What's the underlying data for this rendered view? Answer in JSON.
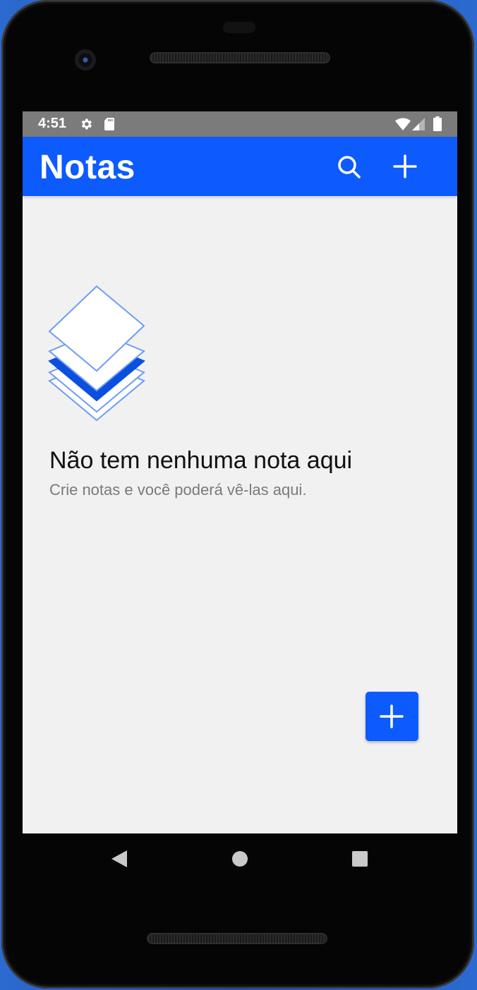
{
  "status_bar": {
    "time": "4:51",
    "icons": [
      "gear-icon",
      "sd-card-icon",
      "wifi-icon",
      "signal-icon",
      "battery-icon"
    ]
  },
  "app_bar": {
    "title": "Notas",
    "actions": [
      "search-icon",
      "add-icon"
    ],
    "background_color": "#0d5bfd"
  },
  "empty_state": {
    "icon": "stacked-layers-icon",
    "title": "Não tem nenhuma nota aqui",
    "subtitle": "Crie notas e você poderá vê-las aqui."
  },
  "fab": {
    "icon": "add-icon",
    "color": "#0d5bfd"
  },
  "nav_bar": {
    "buttons": [
      "back-icon",
      "home-icon",
      "recents-icon"
    ]
  },
  "colors": {
    "accent": "#0d5bfd",
    "screen_background": "#f1f1f1",
    "status_bar": "#7b7b7b"
  }
}
